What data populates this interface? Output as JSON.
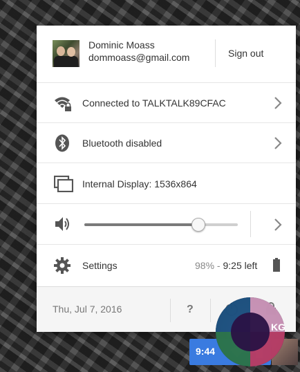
{
  "user": {
    "name": "Dominic Moass",
    "email": "dommoass@gmail.com",
    "sign_out": "Sign out"
  },
  "items": {
    "network": {
      "label": "Connected to TALKTALK89CFAC",
      "icon": "wifi-lock-icon"
    },
    "bluetooth": {
      "label": "Bluetooth disabled",
      "icon": "bluetooth-icon"
    },
    "display": {
      "label": "Internal Display: 1536x864",
      "icon": "display-icon"
    },
    "volume": {
      "icon": "volume-icon",
      "level": 0.74
    },
    "settings": {
      "label": "Settings",
      "icon": "gear-icon",
      "battery_percent": "98%",
      "separator": " - ",
      "battery_time": "9:25 left"
    }
  },
  "footer": {
    "date": "Thu, Jul 7, 2016",
    "help": "?"
  },
  "taskbar": {
    "time": "9:44"
  },
  "logo": {
    "text": "KG"
  },
  "colors": {
    "accent": "#3a7be0",
    "text": "#333333",
    "muted": "#777777"
  }
}
